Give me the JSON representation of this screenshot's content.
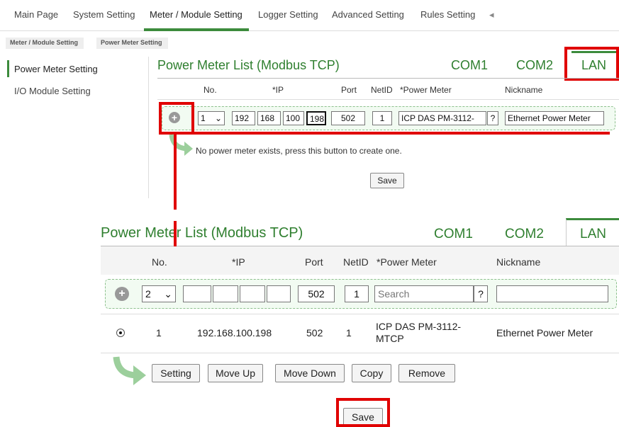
{
  "nav": {
    "items": [
      "Main Page",
      "System Setting",
      "Meter / Module Setting",
      "Logger Setting",
      "Advanced Setting",
      "Rules Setting"
    ],
    "more_icon": "◂"
  },
  "breadcrumb": [
    "Meter / Module Setting",
    "Power Meter Setting"
  ],
  "sidebar": {
    "items": [
      "Power Meter Setting",
      "I/O Module Setting"
    ]
  },
  "panel1": {
    "title": "Power Meter List (Modbus TCP)",
    "tabs": [
      "COM1",
      "COM2",
      "LAN"
    ],
    "headers": [
      "No.",
      "*IP",
      "Port",
      "NetID",
      "*Power Meter",
      "Nickname"
    ],
    "no_value": "1",
    "ip": [
      "192",
      "168",
      "100",
      "198"
    ],
    "port": "502",
    "netid": "1",
    "power_meter": "ICP DAS PM-3112-",
    "help": "?",
    "nickname": "Ethernet Power Meter",
    "message": "No power meter exists, press this button to create one.",
    "save": "Save"
  },
  "panel2": {
    "title": "Power Meter List (Modbus TCP)",
    "tabs": [
      "COM1",
      "COM2",
      "LAN"
    ],
    "headers": [
      "No.",
      "*IP",
      "Port",
      "NetID",
      "*Power Meter",
      "Nickname"
    ],
    "no_value": "2",
    "ip": [
      "",
      "",
      "",
      ""
    ],
    "port": "502",
    "netid": "1",
    "power_meter_placeholder": "Search",
    "help": "?",
    "nickname": "",
    "row": {
      "no": "1",
      "ip": "192.168.100.198",
      "port": "502",
      "netid": "1",
      "meter_line1": "ICP DAS PM-3112-",
      "meter_line2": "MTCP",
      "nickname": "Ethernet Power Meter"
    },
    "buttons": [
      "Setting",
      "Move Up",
      "Move Down",
      "Copy",
      "Remove"
    ],
    "save": "Save"
  },
  "colors": {
    "accent": "#2f7f2f",
    "highlight": "#e00000"
  }
}
